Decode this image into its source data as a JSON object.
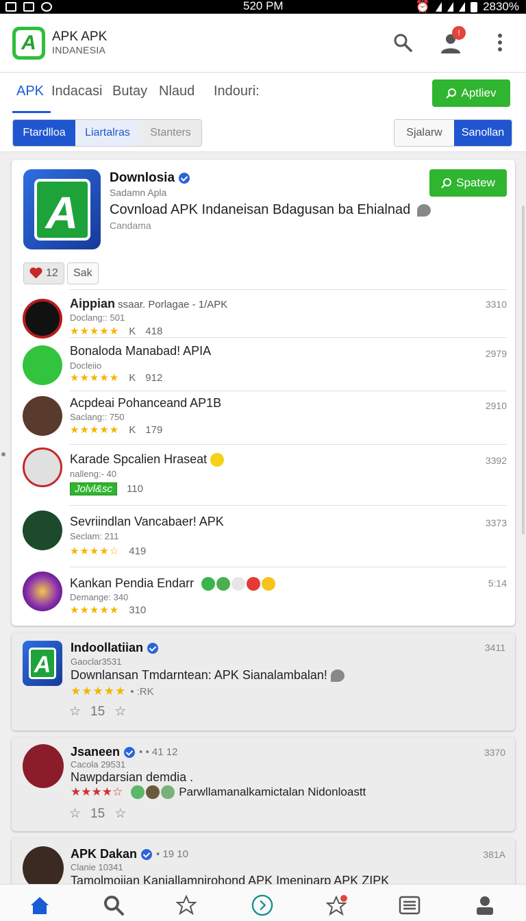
{
  "status": {
    "time": "520 PM",
    "battery": "2830%"
  },
  "header": {
    "title": "APK APK",
    "subtitle": "INDANESIA",
    "logo_letter": "A",
    "notif_count": "!"
  },
  "tabs": {
    "items": [
      {
        "label": "APK",
        "active": true
      },
      {
        "label": "Indacasi"
      },
      {
        "label": "Butay"
      },
      {
        "label": "Nlaud"
      },
      {
        "label": "Indouri:"
      }
    ],
    "action_label": "Aptliev"
  },
  "filters": {
    "left": [
      "Ftardlloa",
      "Liartalras",
      "Stanters"
    ],
    "right": [
      "Sjalarw",
      "Sanollan"
    ]
  },
  "feature": {
    "title": "Downlosia",
    "sub": "Sadamn Apla",
    "headline": "Covnload APK Indaneisan Bdagusan ba Ehialnad",
    "caption": "Candama",
    "button_label": "Spatew",
    "likes": "12",
    "chip2": "Sak",
    "icon_letter": "A"
  },
  "apps": [
    {
      "title_bold": "Aippian",
      "title_rest": " ssaar. Porlagae - 1/APK",
      "sub": "Doclang:: 501",
      "stars": "★★★★★",
      "label": "K",
      "count": "418",
      "num": "3310",
      "avatar_color": "#b71c1c"
    },
    {
      "title_bold": "",
      "title_rest": "Bonaloda Manabad! APIA",
      "sub": "Docleiio",
      "stars": "★★★★★",
      "label": "K",
      "count": "912",
      "num": "2979",
      "avatar_color": "#33c43d"
    },
    {
      "title_bold": "",
      "title_rest": "Acpdeai Pohanceand AP1B",
      "sub": "Saclang:: 750",
      "stars": "★★★★★",
      "label": "K",
      "count": "179",
      "num": "2910",
      "avatar_color": "#5b3a2e"
    },
    {
      "title_bold": "",
      "title_rest": "Karade Spcalien Hraseat",
      "sub": "nalleng:- 40",
      "stars": "Jolvl&sc",
      "label": "",
      "count": "110",
      "num": "3392",
      "avatar_color": "#d8d8d8"
    },
    {
      "title_bold": "",
      "title_rest": "Sevriindlan Vancabaer! APK",
      "sub": "Seclam: 211",
      "stars": "★★★★☆",
      "label": "",
      "count": "419",
      "num": "3373",
      "avatar_color": "#1c4a2a"
    },
    {
      "title_bold": "",
      "title_rest": "Kankan Pendia Endarr",
      "sub": "Demange: 340",
      "stars": "★★★★★",
      "label": "",
      "count": "310",
      "num": "5:14",
      "avatar_color": "#6a2a8f"
    }
  ],
  "posts": [
    {
      "title": "Indoollatiian",
      "extra": "",
      "sub": "Gaoclar3531",
      "body": "Downlansan Tmdarntean: APK Sianalambalan!",
      "meta_stars": "★★★★★",
      "meta_text": "• :RK",
      "actions_count": "15",
      "num": "3411",
      "avatar_color": "#1ea33a"
    },
    {
      "title": "Jsaneen",
      "extra": "• • 41 12",
      "sub": "Cacola 29531",
      "body": "Nawpdarsian demdia .",
      "meta_stars": "★★★★☆",
      "meta_text": "Parwllamanalkamictalan Nidonloastt",
      "actions_count": "15",
      "num": "3370",
      "avatar_color": "#8b1c2a"
    },
    {
      "title": "APK Dakan",
      "extra": "• 19 10",
      "sub": "Clanie 10341",
      "body": "Tamolmoiian Kanjallamnirohond APK Imeninarp APK ZIPK",
      "meta_stars": "",
      "meta_text": "",
      "actions_count": "",
      "num": "381A",
      "avatar_color": "#3a2a22"
    }
  ],
  "colors": {
    "accent": "#1a5bd6",
    "green": "#2fb52f",
    "star": "#f5b400",
    "badge": "#e2453a"
  },
  "nav": [
    {
      "icon": "home-icon",
      "active": true
    },
    {
      "icon": "search-icon"
    },
    {
      "icon": "star-icon"
    },
    {
      "icon": "play-circle-icon"
    },
    {
      "icon": "star-badge-icon"
    },
    {
      "icon": "list-icon"
    },
    {
      "icon": "profile-icon"
    }
  ]
}
